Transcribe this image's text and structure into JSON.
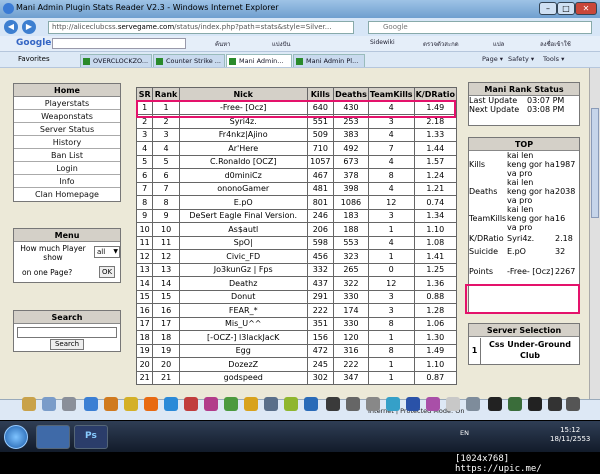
{
  "window": {
    "title": "Mani Admin Plugin Stats Reader V2.3 - Windows Internet Explorer",
    "min": "–",
    "max": "□",
    "close": "✕"
  },
  "address": {
    "prefix": "http://aliceclubcss.",
    "domain": "servegame.com",
    "suffix": "/status/index.php?path=stats&style=Silver...",
    "search_placeholder": "Google"
  },
  "gtoolbar": {
    "logo": "Google",
    "items": [
      "ค้นหา",
      "แบ่งปัน",
      "Sidewiki",
      "ตรวจตัวสะกด",
      "แปล",
      "ลงชื่อเข้าใช้"
    ]
  },
  "favbar": {
    "favorites": "Favorites",
    "tabs": [
      "OVERCLOCKZO...",
      "Counter Strike ...",
      "Mani Admin...",
      "Mani Admin Pl..."
    ],
    "cmds": [
      "Page ▾",
      "Safety ▾",
      "Tools ▾"
    ]
  },
  "home_menu": {
    "title": "Home",
    "items": [
      "Playerstats",
      "Weaponstats",
      "Server Status",
      "History",
      "Ban List",
      "Login",
      "Info",
      "Clan Homepage"
    ]
  },
  "menu_box": {
    "title": "Menu",
    "how_many": "How much Player show",
    "select_value": "all",
    "on_one_page": "on one Page?",
    "ok": "OK"
  },
  "search_box": {
    "title": "Search",
    "button": "Search"
  },
  "stats": {
    "headers": [
      "SR",
      "Rank",
      "Nick",
      "Kills",
      "Deaths",
      "TeamKills",
      "K/DRatio"
    ],
    "rows": [
      [
        "1",
        "1",
        "-Free- [Ocz]",
        "640",
        "430",
        "4",
        "1.49"
      ],
      [
        "2",
        "2",
        "Syri4z.",
        "551",
        "253",
        "3",
        "2.18"
      ],
      [
        "3",
        "3",
        "Fr4nkz|Ajino",
        "509",
        "383",
        "4",
        "1.33"
      ],
      [
        "4",
        "4",
        "Ar'Here",
        "710",
        "492",
        "7",
        "1.44"
      ],
      [
        "5",
        "5",
        "C.Ronaldo [OCZ]",
        "1057",
        "673",
        "4",
        "1.57"
      ],
      [
        "6",
        "6",
        "d0miniCz",
        "467",
        "378",
        "8",
        "1.24"
      ],
      [
        "7",
        "7",
        "ononoGamer",
        "481",
        "398",
        "4",
        "1.21"
      ],
      [
        "8",
        "8",
        "E.pO",
        "801",
        "1086",
        "12",
        "0.74"
      ],
      [
        "9",
        "9",
        "DeSert Eagle Final Version.",
        "246",
        "183",
        "3",
        "1.34"
      ],
      [
        "10",
        "10",
        "As$autl",
        "206",
        "188",
        "1",
        "1.10"
      ],
      [
        "11",
        "11",
        "SpO|",
        "598",
        "553",
        "4",
        "1.08"
      ],
      [
        "12",
        "12",
        "Civic_FD",
        "456",
        "323",
        "1",
        "1.41"
      ],
      [
        "13",
        "13",
        "Jo3kunGz | Fps",
        "332",
        "265",
        "0",
        "1.25"
      ],
      [
        "14",
        "14",
        "Deathz",
        "437",
        "322",
        "12",
        "1.36"
      ],
      [
        "15",
        "15",
        "Donut",
        "291",
        "330",
        "3",
        "0.88"
      ],
      [
        "16",
        "16",
        "FEAR_*",
        "222",
        "174",
        "3",
        "1.28"
      ],
      [
        "17",
        "17",
        "Mis_U^^",
        "351",
        "330",
        "8",
        "1.06"
      ],
      [
        "18",
        "18",
        "[-OCZ-] l3lackJacK",
        "156",
        "120",
        "1",
        "1.30"
      ],
      [
        "19",
        "19",
        "Egg",
        "472",
        "316",
        "8",
        "1.49"
      ],
      [
        "20",
        "20",
        "DozezZ",
        "245",
        "222",
        "1",
        "1.10"
      ],
      [
        "21",
        "21",
        "godspeed",
        "302",
        "347",
        "1",
        "0.87"
      ]
    ]
  },
  "rank_status": {
    "title": "Mani Rank Status",
    "rows": [
      [
        "Last Update",
        "03:07 PM"
      ],
      [
        "Next Update",
        "03:08 PM"
      ]
    ]
  },
  "top": {
    "title": "TOP",
    "rows": [
      [
        "Kills",
        "kai len keng gor ha va pro",
        "1987"
      ],
      [
        "Deaths",
        "kai len keng gor ha va pro",
        "2038"
      ],
      [
        "TeamKills",
        "kai len keng gor ha va pro",
        "16"
      ],
      [
        "K/DRatio",
        "Syri4z.",
        "2.18"
      ],
      [
        "Suicide",
        "E.pO",
        "32"
      ],
      [
        "Points",
        "-Free- [Ocz]",
        "2267"
      ]
    ]
  },
  "server_selection": {
    "title": "Server Selection",
    "num": "1",
    "name": "Css Under-Ground Club"
  },
  "statusbar": {
    "zone": "Internet | Protected Mode: On"
  },
  "taskbar": {
    "lang": "EN",
    "time": "15:12",
    "date": "18/11/2553"
  },
  "watermark": "[1024x768] https://upic.me/",
  "colors": {
    "highlight": "#e4126b",
    "header_bg": "#d4d0c8",
    "page_bg": "#ece9d8"
  }
}
